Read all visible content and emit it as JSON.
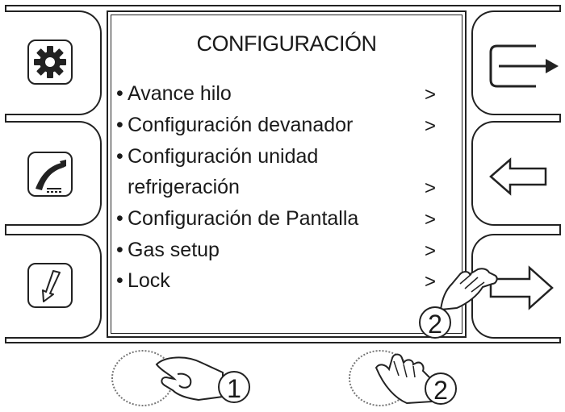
{
  "screen": {
    "title": "CONFIGURACIÓN",
    "menu": [
      {
        "bullet": "•",
        "label": "Avance hilo",
        "arrow": ">"
      },
      {
        "bullet": "•",
        "label": "Configuración devanador",
        "arrow": ">"
      },
      {
        "bullet": "•",
        "label": "Configuración unidad",
        "arrow": ""
      },
      {
        "bullet": "",
        "label": "refrigeración",
        "arrow": ">"
      },
      {
        "bullet": "•",
        "label": "Configuración de Pantalla",
        "arrow": ">"
      },
      {
        "bullet": "•",
        "label": "Gas setup",
        "arrow": ">"
      },
      {
        "bullet": "•",
        "label": "Lock",
        "arrow": ">"
      }
    ]
  },
  "left_buttons": [
    {
      "icon": "gear-icon"
    },
    {
      "icon": "welding-torch-icon"
    },
    {
      "icon": "wire-feed-arrow-icon"
    }
  ],
  "right_buttons": [
    {
      "icon": "exit-icon"
    },
    {
      "icon": "back-arrow-icon"
    },
    {
      "icon": "forward-arrow-icon"
    }
  ],
  "annotations": {
    "step_1": "1",
    "step_2_knob": "2",
    "step_2_button": "2"
  },
  "colors": {
    "line": "#222222",
    "background": "#ffffff",
    "dashed": "#777777"
  }
}
